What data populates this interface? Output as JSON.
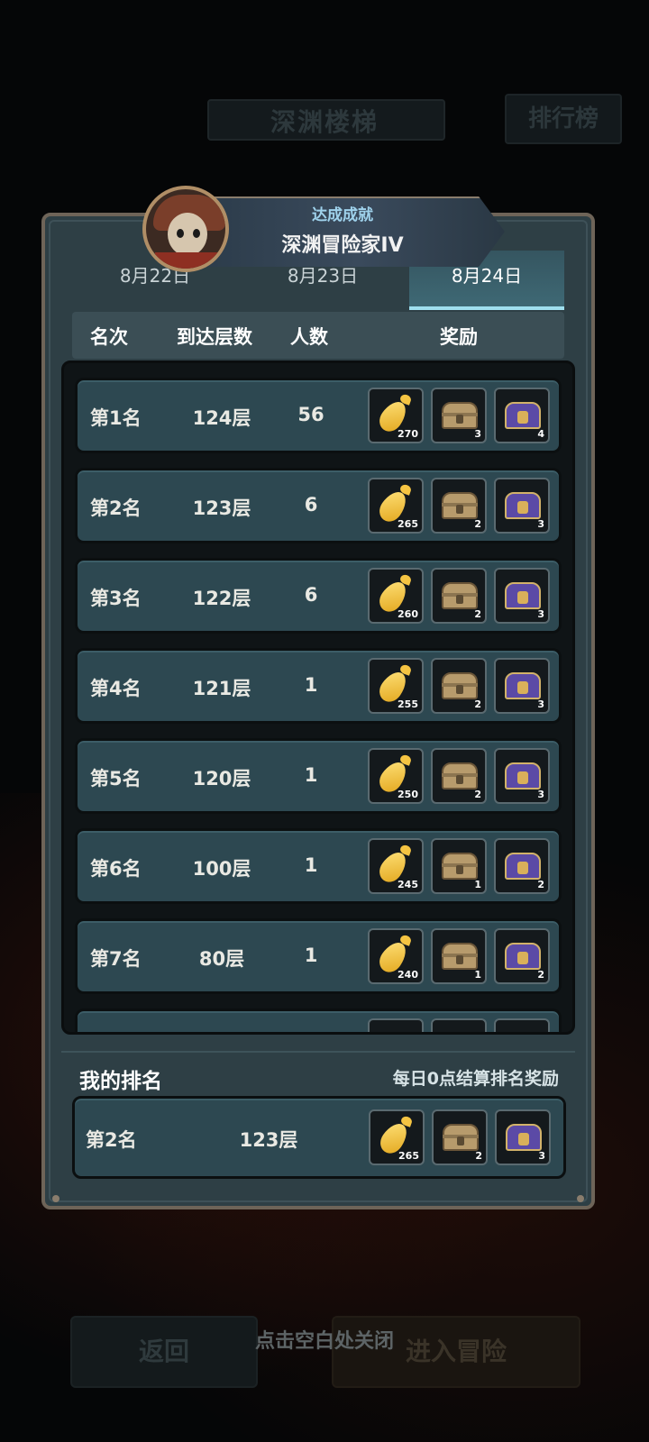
{
  "background": {
    "title": "深渊楼梯",
    "rank_button": "排行榜",
    "back_button": "返回",
    "enter_button": "进入冒险",
    "close_hint": "点击空白处关闭"
  },
  "achievement": {
    "subtitle": "达成成就",
    "title": "深渊冒险家IV"
  },
  "tabs": [
    {
      "label": "8月22日",
      "active": false
    },
    {
      "label": "8月23日",
      "active": false
    },
    {
      "label": "8月24日",
      "active": true
    }
  ],
  "table_header": {
    "rank": "名次",
    "floors": "到达层数",
    "count": "人数",
    "reward": "奖励"
  },
  "rows": [
    {
      "rank": "第1名",
      "floor": "124层",
      "count": "56",
      "rewards": [
        "270",
        "3",
        "4"
      ]
    },
    {
      "rank": "第2名",
      "floor": "123层",
      "count": "6",
      "rewards": [
        "265",
        "2",
        "3"
      ]
    },
    {
      "rank": "第3名",
      "floor": "122层",
      "count": "6",
      "rewards": [
        "260",
        "2",
        "3"
      ]
    },
    {
      "rank": "第4名",
      "floor": "121层",
      "count": "1",
      "rewards": [
        "255",
        "2",
        "3"
      ]
    },
    {
      "rank": "第5名",
      "floor": "120层",
      "count": "1",
      "rewards": [
        "250",
        "2",
        "3"
      ]
    },
    {
      "rank": "第6名",
      "floor": "100层",
      "count": "1",
      "rewards": [
        "245",
        "1",
        "2"
      ]
    },
    {
      "rank": "第7名",
      "floor": "80层",
      "count": "1",
      "rewards": [
        "240",
        "1",
        "2"
      ]
    }
  ],
  "reward_icons": [
    "carrot-icon",
    "treasure-chest-icon",
    "purple-chest-icon"
  ],
  "my_rank": {
    "label": "我的排名",
    "note": "每日0点结算排名奖励",
    "rank": "第2名",
    "floor": "123层",
    "rewards": [
      "265",
      "2",
      "3"
    ]
  },
  "colors": {
    "panel": "#2e3f45",
    "row": "#2d4851",
    "tab_active": "#3f6a76",
    "accent": "#9fe0ef"
  }
}
